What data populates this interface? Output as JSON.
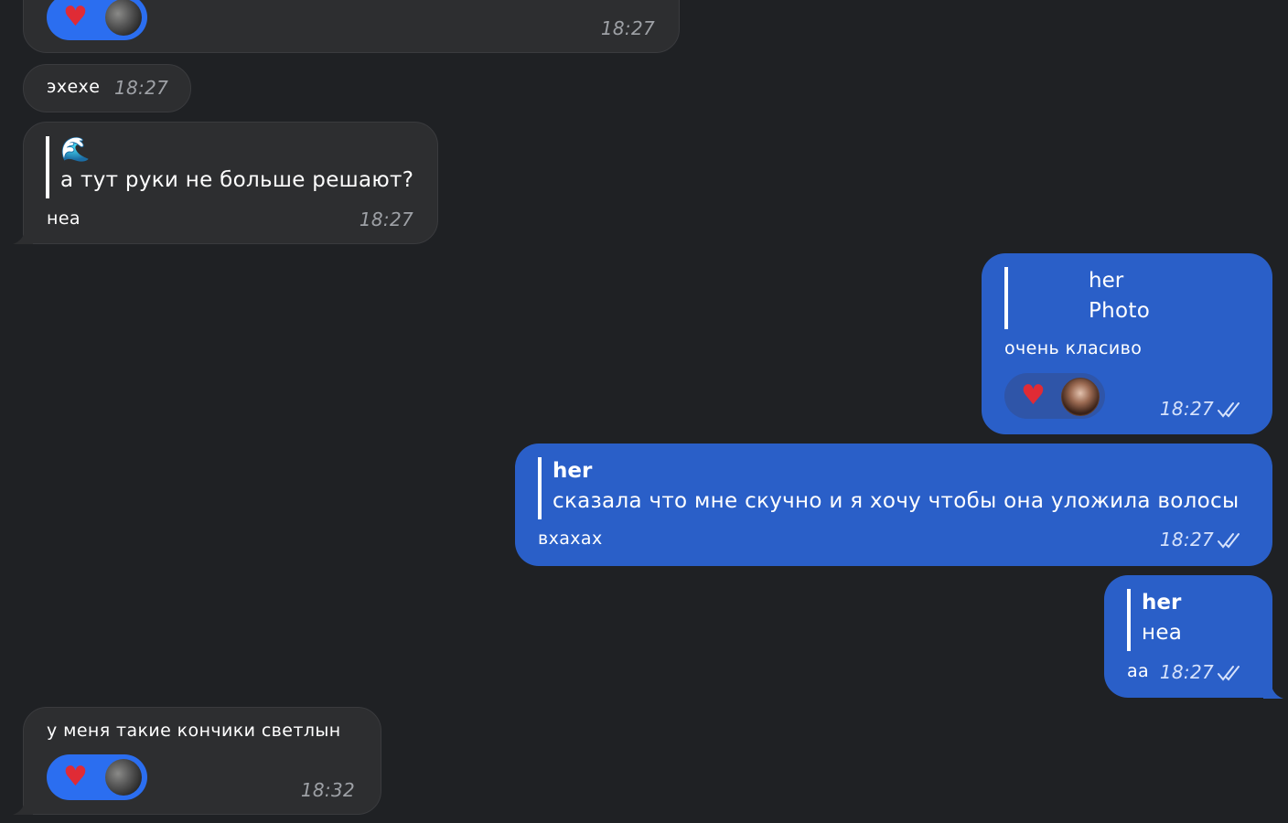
{
  "messages": [
    {
      "id": "m1",
      "direction": "incoming",
      "time": "18:27",
      "reactions": [
        {
          "emoji": "♥",
          "avatar": "user-avatar"
        }
      ]
    },
    {
      "id": "m2",
      "direction": "incoming",
      "text": "эхехе",
      "time": "18:27"
    },
    {
      "id": "m3",
      "direction": "incoming",
      "quote": {
        "author_emoji": "🌊",
        "text": "а тут руки не больше решают?"
      },
      "text": "неа",
      "time": "18:27"
    },
    {
      "id": "m4",
      "direction": "outgoing",
      "quote": {
        "author": "her",
        "text": "Photo"
      },
      "text": "очень класиво",
      "time": "18:27",
      "status": "read",
      "reactions": [
        {
          "emoji": "♥",
          "avatar": "her-avatar"
        }
      ]
    },
    {
      "id": "m5",
      "direction": "outgoing",
      "quote": {
        "author": "her",
        "text": "сказала что мне скучно и я хочу чтобы она уложила волосы"
      },
      "text": "вхахах",
      "time": "18:27",
      "status": "read"
    },
    {
      "id": "m6",
      "direction": "outgoing",
      "quote": {
        "author": "her",
        "text": "неа"
      },
      "text": "аа",
      "time": "18:27",
      "status": "read"
    },
    {
      "id": "m7",
      "direction": "incoming",
      "text": "у меня такие кончики светлын",
      "time": "18:32",
      "reactions": [
        {
          "emoji": "♥",
          "avatar": "user-avatar"
        }
      ]
    }
  ],
  "colors": {
    "background": "#1f2124",
    "incoming_bubble": "#2d2e30",
    "outgoing_bubble": "#2a5fc8",
    "reaction_pill": "#2b6ef0",
    "heart": "#e02b35"
  }
}
